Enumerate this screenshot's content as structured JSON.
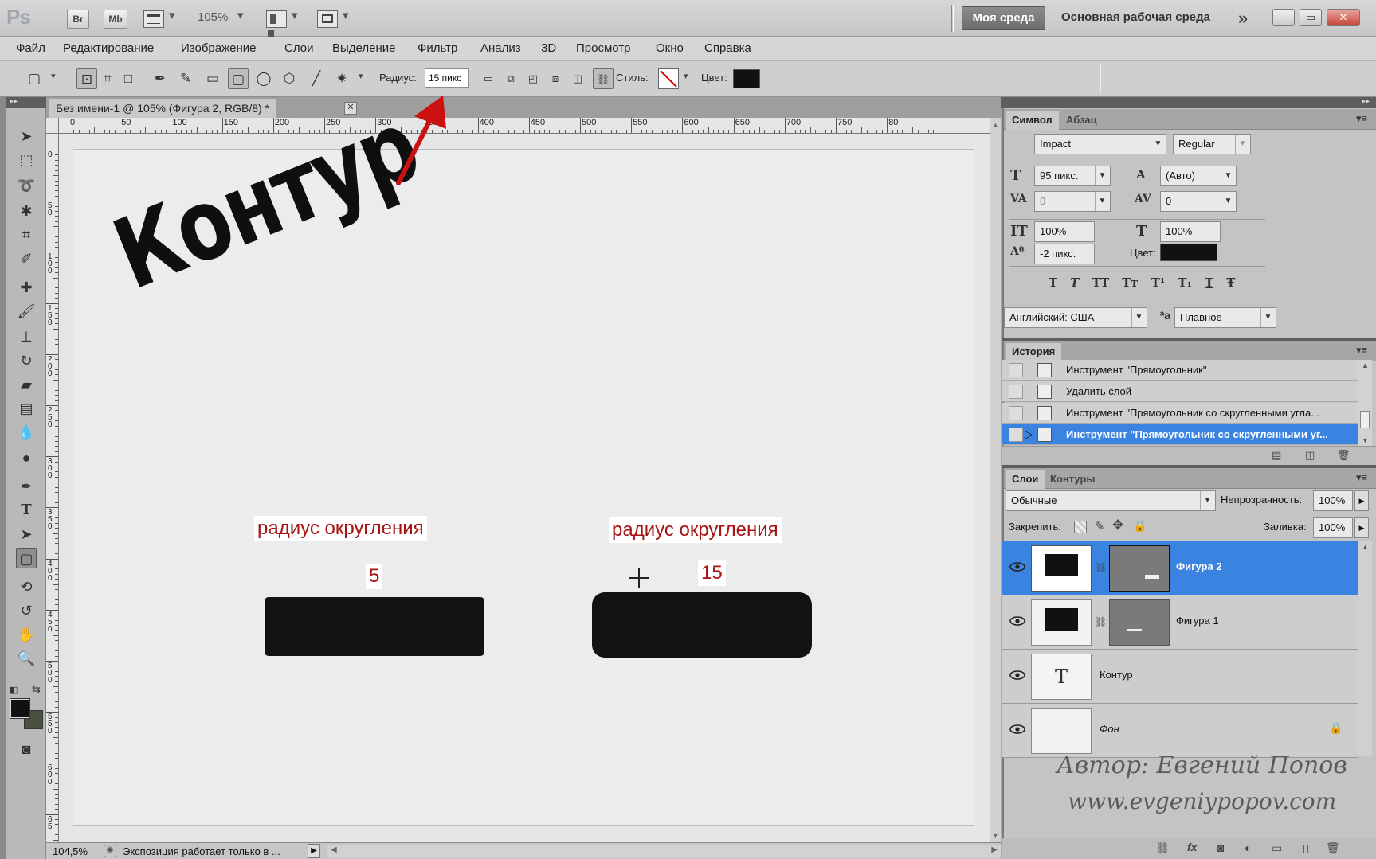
{
  "app": {
    "logo": "Ps",
    "bridge_btn": "Br",
    "minibridge_btn": "Mb",
    "zoom": "105%",
    "workspace_active": "Моя среда",
    "workspace_other": "Основная рабочая среда"
  },
  "menu": [
    "Файл",
    "Редактирование",
    "Изображение",
    "Слои",
    "Выделение",
    "Фильтр",
    "Анализ",
    "3D",
    "Просмотр",
    "Окно",
    "Справка"
  ],
  "options": {
    "radius_label": "Радиус:",
    "radius_value": "15 пикс",
    "style_label": "Стиль:",
    "color_label": "Цвет:"
  },
  "document": {
    "tab_title": "Без имени-1 @ 105% (Фигура 2, RGB/8) *",
    "ruler_h": [
      "0",
      "50",
      "100",
      "150",
      "200",
      "250",
      "300",
      "350",
      "400",
      "450",
      "500",
      "550",
      "600",
      "650",
      "700",
      "750",
      "80"
    ],
    "ruler_v": [
      "0",
      "50",
      "100",
      "150",
      "200",
      "250",
      "300",
      "350",
      "400",
      "450",
      "500",
      "550",
      "600",
      "65"
    ],
    "heading_text": "Контур",
    "label_left": "радиус округления",
    "value_left": "5",
    "label_right": "радиус округления",
    "value_right": "15"
  },
  "status": {
    "zoom": "104,5%",
    "message": "Экспозиция работает только в ..."
  },
  "character": {
    "tab_character": "Символ",
    "tab_paragraph": "Абзац",
    "font_family": "Impact",
    "font_style": "Regular",
    "size": "95 пикс.",
    "leading": "(Авто)",
    "kerning": "0",
    "tracking": "0",
    "vscale": "100%",
    "hscale": "100%",
    "baseline": "-2 пикс.",
    "color_label": "Цвет:",
    "language": "Английский: США",
    "antialias_label": "ªa",
    "antialias": "Плавное",
    "style_buttons": [
      "T",
      "T",
      "TT",
      "Tт",
      "T¹",
      "T₁",
      "T",
      "Ŧ"
    ]
  },
  "history": {
    "title": "История",
    "items": [
      "Инструмент \"Прямоугольник\"",
      "Удалить слой",
      "Инструмент \"Прямоугольник со скругленными угла...",
      "Инструмент \"Прямоугольник со скругленными уг..."
    ]
  },
  "layers": {
    "tab_layers": "Слои",
    "tab_paths": "Контуры",
    "blend_mode": "Обычные",
    "opacity_label": "Непрозрачность:",
    "opacity": "100%",
    "lock_label": "Закрепить:",
    "fill_label": "Заливка:",
    "fill": "100%",
    "items": [
      {
        "name": "Фигура 2"
      },
      {
        "name": "Фигура 1"
      },
      {
        "name": "Контур",
        "thumb_glyph": "T"
      },
      {
        "name": "Фон"
      }
    ]
  },
  "watermark": {
    "line1": "Автор: Евгений Попов",
    "line2": "www.evgeniypopov.com"
  },
  "colors": {
    "selection_blue": "#3a83e0",
    "label_red": "#a71212",
    "arrow_red": "#cc1111",
    "foreground": "#111111",
    "background_swatch": "#4b5140"
  }
}
